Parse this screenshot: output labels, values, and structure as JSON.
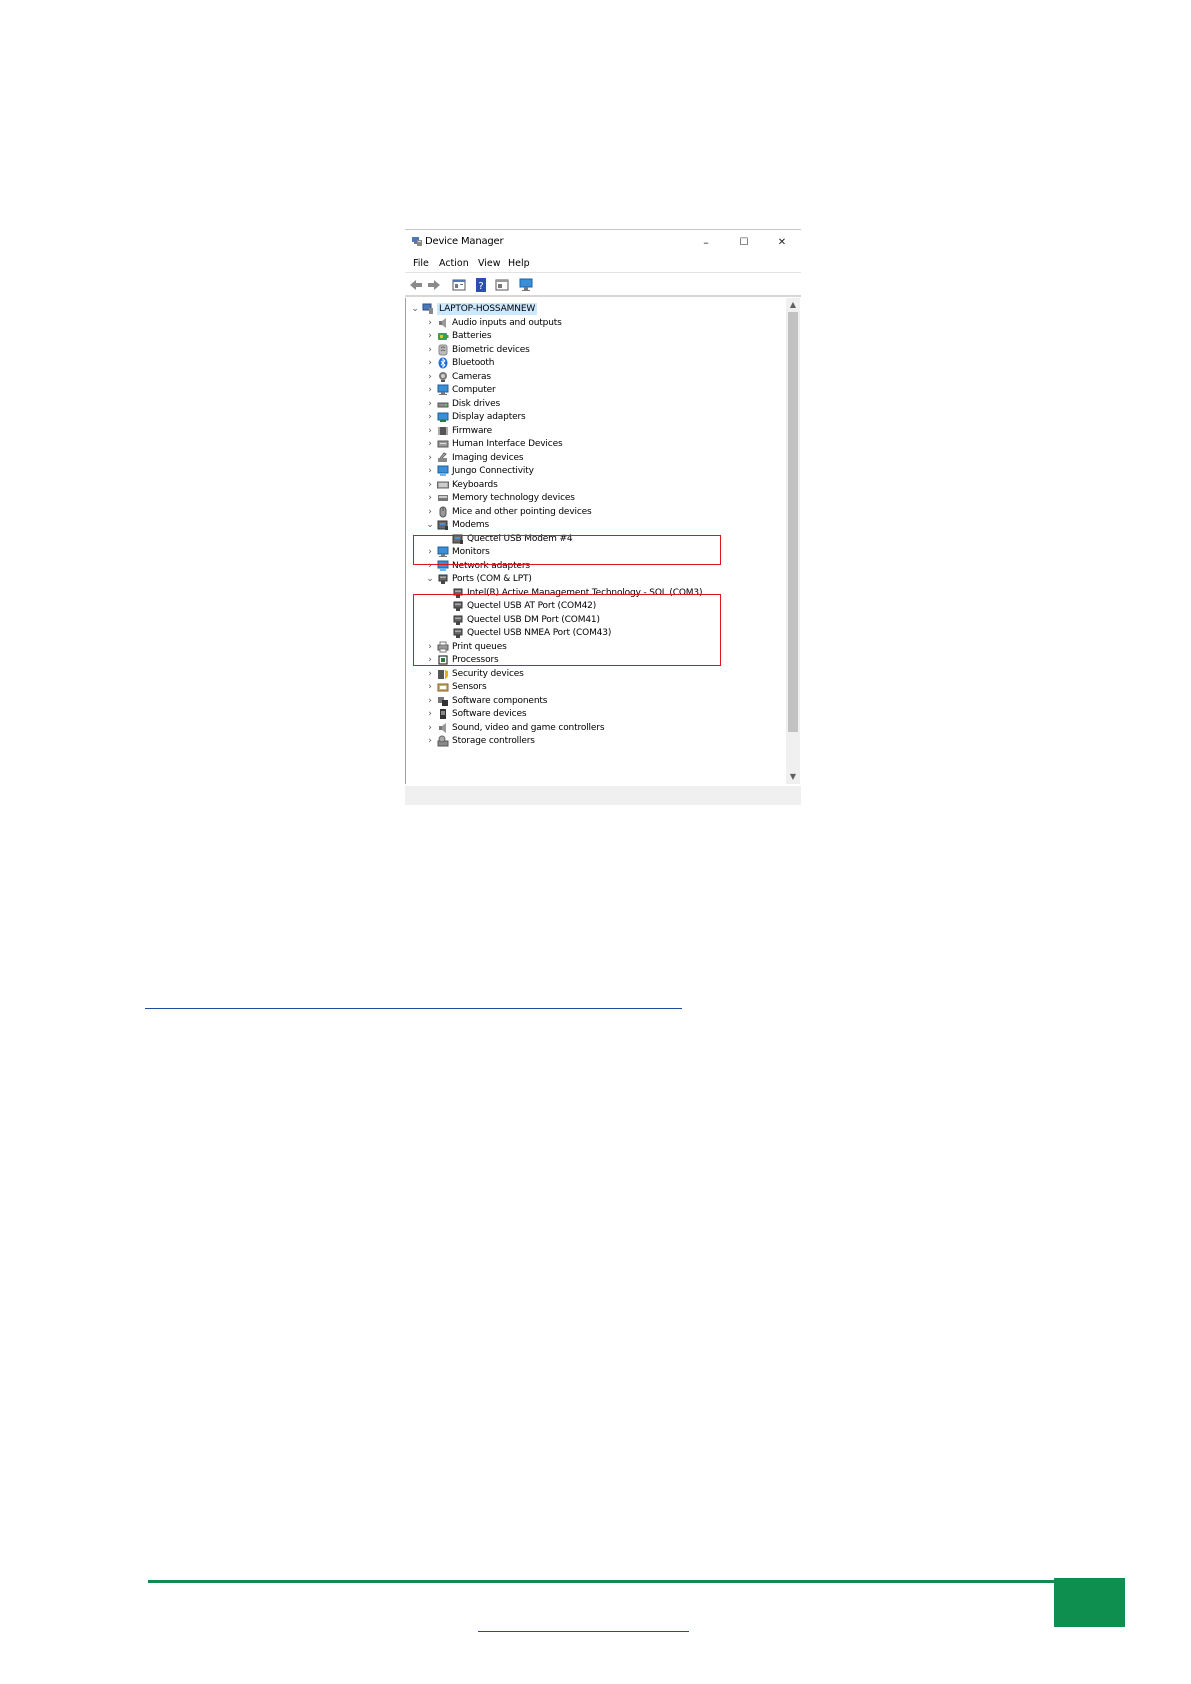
{
  "window": {
    "title": "Device Manager",
    "controls": {
      "minimize": "–",
      "maximize": "☐",
      "close": "✕"
    }
  },
  "menu": [
    "File",
    "Action",
    "View",
    "Help"
  ],
  "toolbar_icons": [
    "back-arrow-icon",
    "forward-arrow-icon",
    "properties-icon",
    "help-icon",
    "view-icon",
    "monitor-icon"
  ],
  "tree": {
    "root": "LAPTOP-HOSSAMNEW",
    "items": [
      {
        "label": "Audio inputs and outputs",
        "icon": "speaker-icon",
        "expanded": false
      },
      {
        "label": "Batteries",
        "icon": "battery-icon",
        "expanded": false
      },
      {
        "label": "Biometric devices",
        "icon": "biometric-icon",
        "expanded": false
      },
      {
        "label": "Bluetooth",
        "icon": "bluetooth-icon",
        "expanded": false
      },
      {
        "label": "Cameras",
        "icon": "camera-icon",
        "expanded": false
      },
      {
        "label": "Computer",
        "icon": "computer-icon",
        "expanded": false
      },
      {
        "label": "Disk drives",
        "icon": "disk-drive-icon",
        "expanded": false
      },
      {
        "label": "Display adapters",
        "icon": "display-adapter-icon",
        "expanded": false
      },
      {
        "label": "Firmware",
        "icon": "firmware-icon",
        "expanded": false
      },
      {
        "label": "Human Interface Devices",
        "icon": "hid-icon",
        "expanded": false
      },
      {
        "label": "Imaging devices",
        "icon": "scanner-icon",
        "expanded": false
      },
      {
        "label": "Jungo Connectivity",
        "icon": "network-icon",
        "expanded": false
      },
      {
        "label": "Keyboards",
        "icon": "keyboard-icon",
        "expanded": false
      },
      {
        "label": "Memory technology devices",
        "icon": "memory-icon",
        "expanded": false
      },
      {
        "label": "Mice and other pointing devices",
        "icon": "mouse-icon",
        "expanded": false
      },
      {
        "label": "Modems",
        "icon": "modem-icon",
        "expanded": true,
        "children": [
          {
            "label": "Quectel USB Modem #4",
            "icon": "modem-icon"
          }
        ]
      },
      {
        "label": "Monitors",
        "icon": "monitor-icon",
        "expanded": false
      },
      {
        "label": "Network adapters",
        "icon": "network-icon",
        "expanded": false
      },
      {
        "label": "Ports (COM & LPT)",
        "icon": "port-icon",
        "expanded": true,
        "children": [
          {
            "label": "Intel(R) Active Management Technology - SOL (COM3)",
            "icon": "port-icon"
          },
          {
            "label": "Quectel USB AT Port (COM42)",
            "icon": "port-icon"
          },
          {
            "label": "Quectel USB DM Port (COM41)",
            "icon": "port-icon"
          },
          {
            "label": "Quectel USB NMEA Port (COM43)",
            "icon": "port-icon"
          }
        ]
      },
      {
        "label": "Print queues",
        "icon": "printer-icon",
        "expanded": false
      },
      {
        "label": "Processors",
        "icon": "processor-icon",
        "expanded": false
      },
      {
        "label": "Security devices",
        "icon": "security-icon",
        "expanded": false
      },
      {
        "label": "Sensors",
        "icon": "sensor-icon",
        "expanded": false
      },
      {
        "label": "Software components",
        "icon": "software-component-icon",
        "expanded": false
      },
      {
        "label": "Software devices",
        "icon": "software-device-icon",
        "expanded": false
      },
      {
        "label": "Sound, video and game controllers",
        "icon": "speaker-icon",
        "expanded": false
      },
      {
        "label": "Storage controllers",
        "icon": "storage-icon",
        "expanded": false
      }
    ]
  },
  "colors": {
    "highlight_box": "#e0141e",
    "selection": "#cce8ff",
    "footer_green": "#0e8f4f",
    "link_blue": "#1f4e96"
  }
}
